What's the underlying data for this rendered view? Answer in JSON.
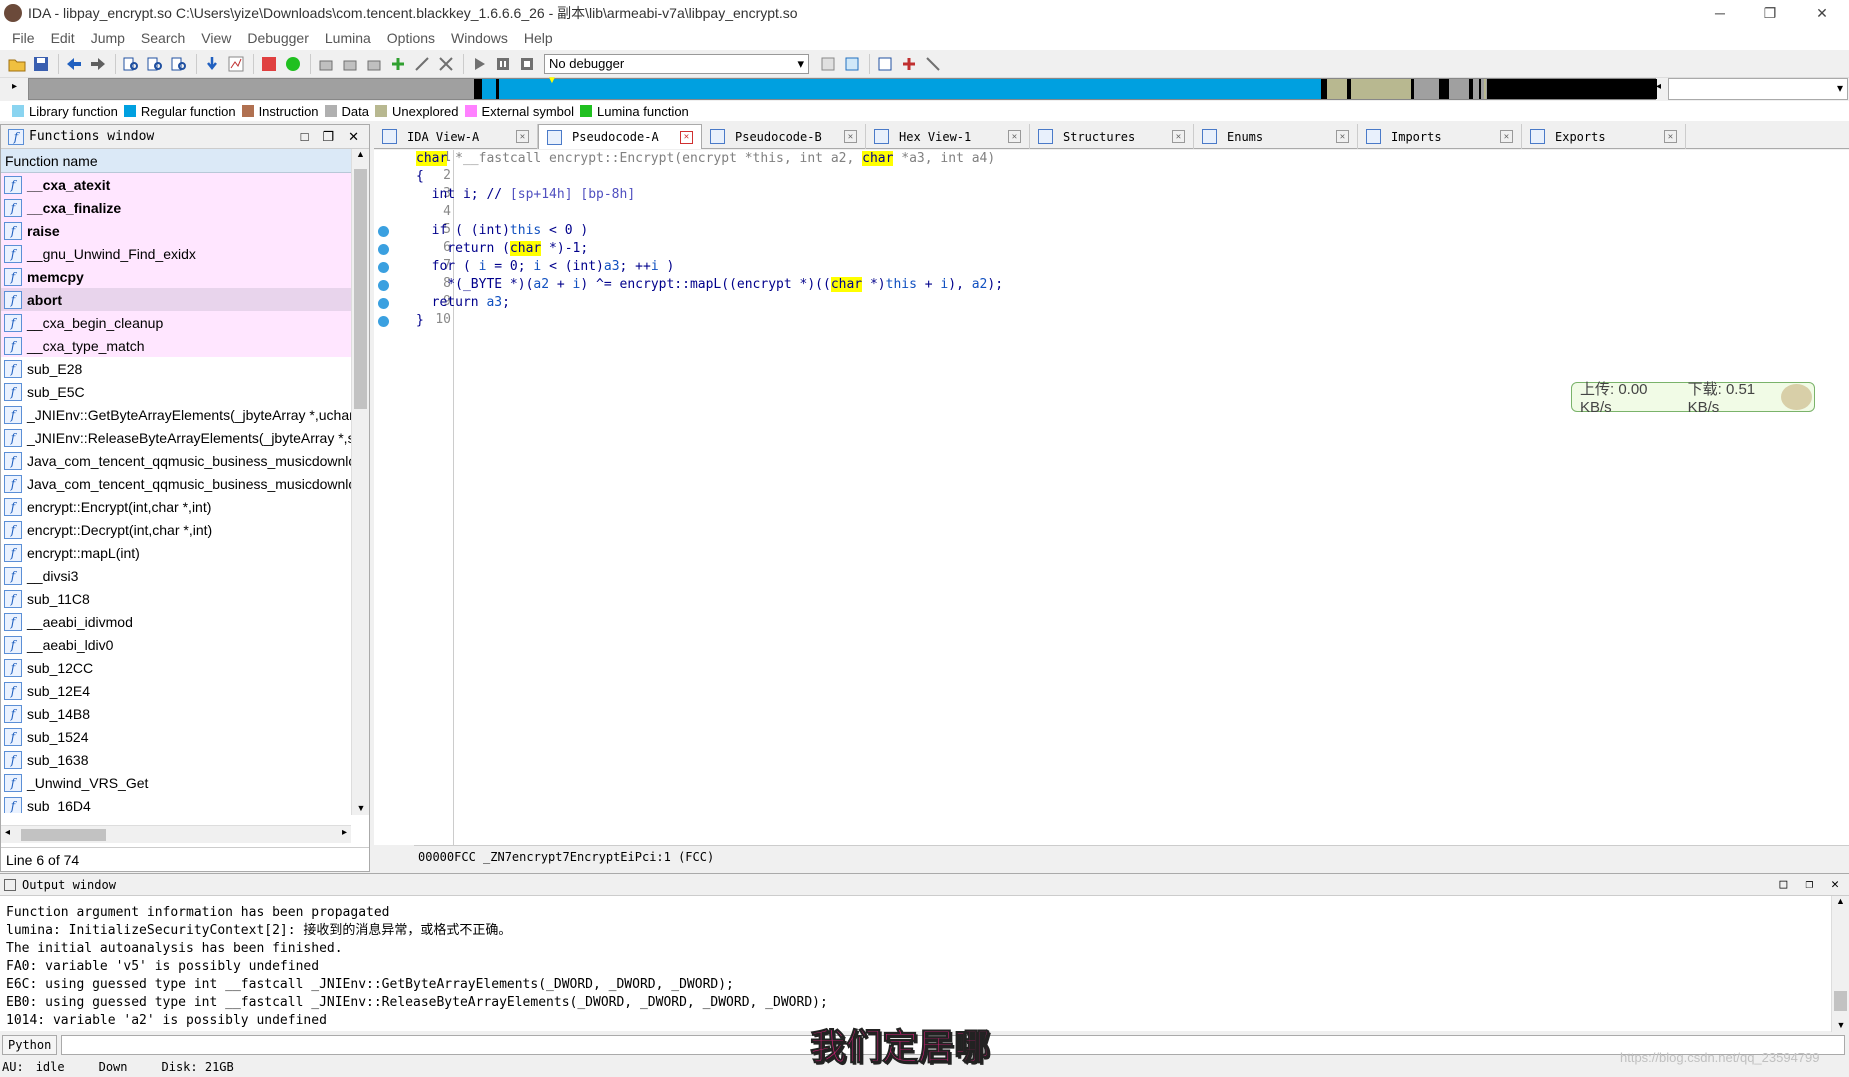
{
  "window": {
    "title": "IDA - libpay_encrypt.so C:\\Users\\yize\\Downloads\\com.tencent.blackkey_1.6.6.6_26 - 副本\\lib\\armeabi-v7a\\libpay_encrypt.so",
    "minimize": "─",
    "restore": "❐",
    "close": "✕"
  },
  "menu": [
    "File",
    "Edit",
    "Jump",
    "Search",
    "View",
    "Debugger",
    "Lumina",
    "Options",
    "Windows",
    "Help"
  ],
  "toolbar": {
    "debugger_select": "No debugger"
  },
  "legend": [
    {
      "label": "Library function",
      "color": "#8ad4f0"
    },
    {
      "label": "Regular function",
      "color": "#00a0e0"
    },
    {
      "label": "Instruction",
      "color": "#b07050"
    },
    {
      "label": "Data",
      "color": "#b0b0b0"
    },
    {
      "label": "Unexplored",
      "color": "#b8b890"
    },
    {
      "label": "External symbol",
      "color": "#ff80ff"
    },
    {
      "label": "Lumina function",
      "color": "#20c020"
    }
  ],
  "functions_window": {
    "title": "Functions window",
    "column": "Function name",
    "status": "Line 6 of 74",
    "items": [
      {
        "name": "__cxa_atexit",
        "lib": true,
        "bold": true
      },
      {
        "name": "__cxa_finalize",
        "lib": true,
        "bold": true
      },
      {
        "name": "raise",
        "lib": true,
        "bold": true
      },
      {
        "name": "__gnu_Unwind_Find_exidx",
        "lib": true,
        "bold": false
      },
      {
        "name": "memcpy",
        "lib": true,
        "bold": true
      },
      {
        "name": "abort",
        "lib": true,
        "bold": true
      },
      {
        "name": "__cxa_begin_cleanup",
        "lib": true,
        "bold": false
      },
      {
        "name": "__cxa_type_match",
        "lib": true,
        "bold": false
      },
      {
        "name": "sub_E28",
        "lib": false,
        "bold": false
      },
      {
        "name": "sub_E5C",
        "lib": false,
        "bold": false
      },
      {
        "name": "_JNIEnv::GetByteArrayElements(_jbyteArray *,uchar *",
        "lib": false,
        "bold": false
      },
      {
        "name": "_JNIEnv::ReleaseByteArrayElements(_jbyteArray *,sign",
        "lib": false,
        "bold": false
      },
      {
        "name": "Java_com_tencent_qqmusic_business_musicdownloa",
        "lib": false,
        "bold": false
      },
      {
        "name": "Java_com_tencent_qqmusic_business_musicdownloa",
        "lib": false,
        "bold": false
      },
      {
        "name": "encrypt::Encrypt(int,char *,int)",
        "lib": false,
        "bold": false
      },
      {
        "name": "encrypt::Decrypt(int,char *,int)",
        "lib": false,
        "bold": false
      },
      {
        "name": "encrypt::mapL(int)",
        "lib": false,
        "bold": false
      },
      {
        "name": "__divsi3",
        "lib": false,
        "bold": false
      },
      {
        "name": "sub_11C8",
        "lib": false,
        "bold": false
      },
      {
        "name": "__aeabi_idivmod",
        "lib": false,
        "bold": false
      },
      {
        "name": "__aeabi_ldiv0",
        "lib": false,
        "bold": false
      },
      {
        "name": "sub_12CC",
        "lib": false,
        "bold": false
      },
      {
        "name": "sub_12E4",
        "lib": false,
        "bold": false
      },
      {
        "name": "sub_14B8",
        "lib": false,
        "bold": false
      },
      {
        "name": "sub_1524",
        "lib": false,
        "bold": false
      },
      {
        "name": "sub_1638",
        "lib": false,
        "bold": false
      },
      {
        "name": "_Unwind_VRS_Get",
        "lib": false,
        "bold": false
      },
      {
        "name": "sub_16D4",
        "lib": false,
        "bold": false
      }
    ]
  },
  "tabs": [
    {
      "label": "IDA View-A",
      "active": false
    },
    {
      "label": "Pseudocode-A",
      "active": true
    },
    {
      "label": "Pseudocode-B",
      "active": false
    },
    {
      "label": "Hex View-1",
      "active": false
    },
    {
      "label": "Structures",
      "active": false
    },
    {
      "label": "Enums",
      "active": false
    },
    {
      "label": "Imports",
      "active": false
    },
    {
      "label": "Exports",
      "active": false
    }
  ],
  "code": {
    "line_numbers": [
      "1",
      "2",
      "3",
      "4",
      "5",
      "6",
      "7",
      "8",
      "9",
      "10"
    ],
    "l1": {
      "a": "char",
      "b": " *__fastcall encrypt::Encrypt(encrypt *this, int a2, ",
      "c": "char",
      "d": " *a3, int a4)"
    },
    "l2": "{",
    "l3": {
      "a": "  int i; // ",
      "b": "[sp+14h] [bp-8h]"
    },
    "l5": {
      "a": "  if ( (int)",
      "b": "this",
      "c": " < 0 )"
    },
    "l6": {
      "a": "    return (",
      "b": "char",
      "c": " *)-1;"
    },
    "l7": {
      "a": "  for ( ",
      "b": "i",
      "c": " = 0; ",
      "d": "i",
      "e": " < (int)",
      "f": "a3",
      "g": "; ++",
      "h": "i",
      "i": " )"
    },
    "l8": {
      "a": "    *(_BYTE *)(",
      "b": "a2",
      "c": " + ",
      "d": "i",
      "e": ") ^= encrypt::mapL((encrypt *)((",
      "f": "char",
      "g": " *)",
      "h": "this",
      "i": " + ",
      "j": "i",
      "k": "), ",
      "l": "a2",
      "m": ");"
    },
    "l9": {
      "a": "  return ",
      "b": "a3",
      "c": ";"
    },
    "l10": "}",
    "status": "00000FCC _ZN7encrypt7EncryptEiPci:1 (FCC)"
  },
  "net_widget": {
    "up": "上传: 0.00 KB/s",
    "down": "下载: 0.51 KB/s"
  },
  "output": {
    "title": "Output window",
    "lines": [
      "Function argument information has been propagated",
      "lumina: InitializeSecurityContext[2]: 接收到的消息异常，或格式不正确。",
      "The initial autoanalysis has been finished.",
      "FA0: variable 'v5' is possibly undefined",
      "E6C: using guessed type int __fastcall _JNIEnv::GetByteArrayElements(_DWORD, _DWORD, _DWORD);",
      "EB0: using guessed type int __fastcall _JNIEnv::ReleaseByteArrayElements(_DWORD, _DWORD, _DWORD, _DWORD);",
      "1014: variable 'a2' is possibly undefined"
    ]
  },
  "python_button": "Python",
  "status": {
    "au": "AU:",
    "state": "idle",
    "dir": "Down",
    "disk": "Disk: 21GB"
  },
  "subtitle": "我们定居哪",
  "watermark": "https://blog.csdn.net/qq_23594799"
}
